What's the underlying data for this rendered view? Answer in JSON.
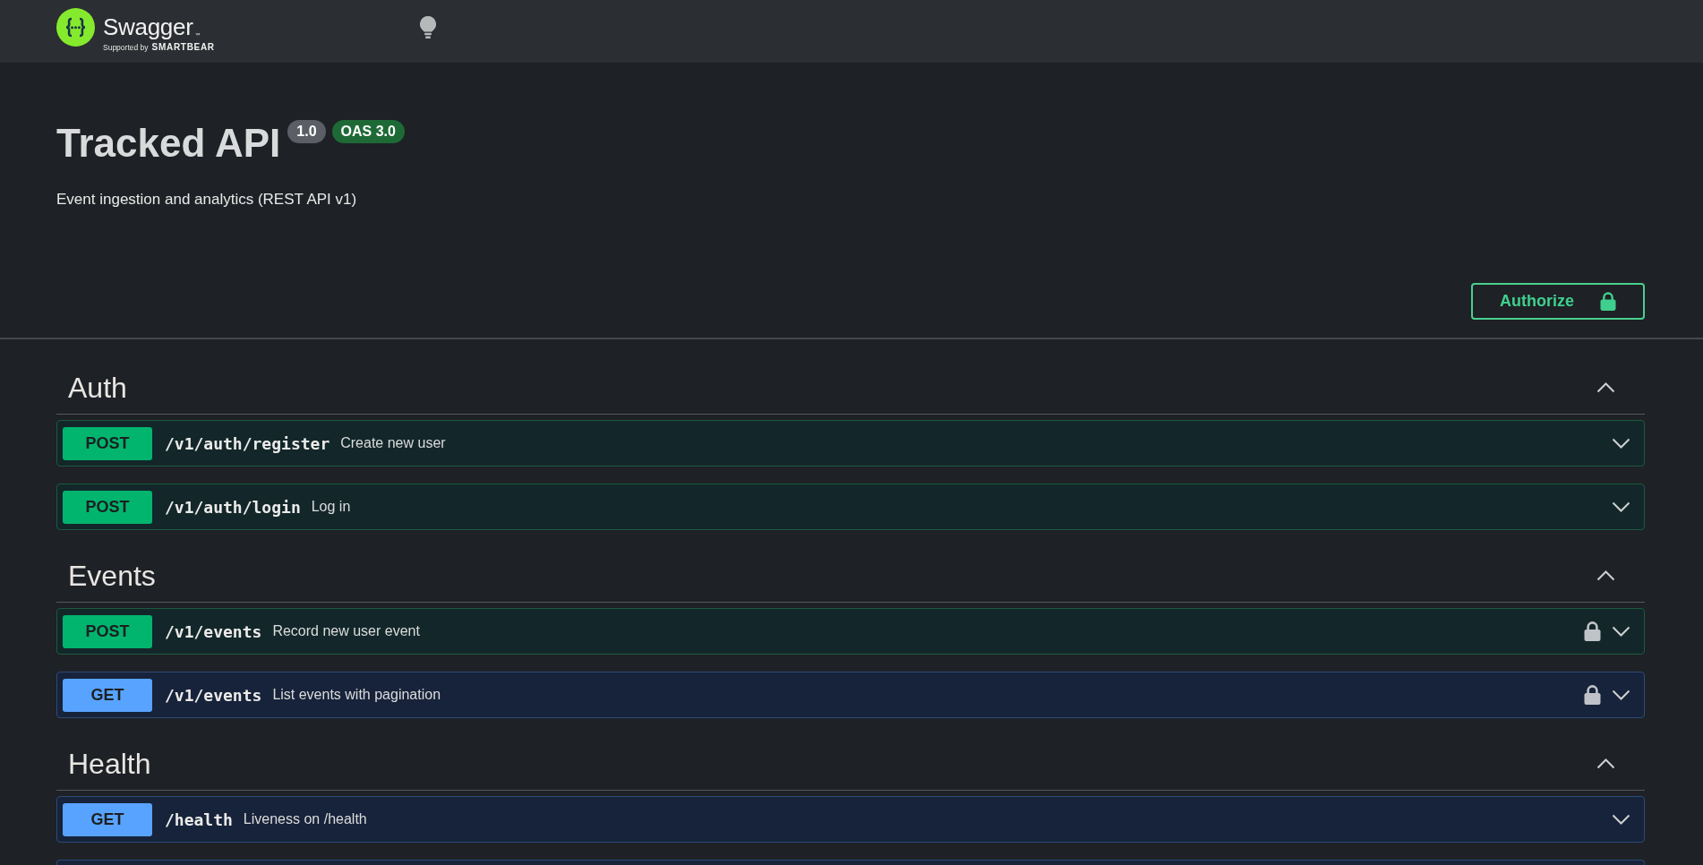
{
  "header": {
    "logo": {
      "name": "Swagger",
      "trademark": "™",
      "tagline": "Supported by",
      "company": "SMARTBEAR"
    }
  },
  "info": {
    "title": "Tracked API",
    "version": "1.0",
    "spec_version": "OAS 3.0",
    "description": "Event ingestion and analytics (REST API v1)"
  },
  "authorize_button": {
    "label": "Authorize"
  },
  "sections": [
    {
      "name": "Auth",
      "expanded": true,
      "operations": [
        {
          "kind": "post",
          "method": "POST",
          "path": "/v1/auth/register",
          "summary": "Create new user",
          "secured": false,
          "expanded": false
        },
        {
          "kind": "post",
          "method": "POST",
          "path": "/v1/auth/login",
          "summary": "Log in",
          "secured": false,
          "expanded": false
        }
      ]
    },
    {
      "name": "Events",
      "expanded": true,
      "operations": [
        {
          "kind": "post",
          "method": "POST",
          "path": "/v1/events",
          "summary": "Record new user event",
          "secured": true,
          "expanded": false
        },
        {
          "kind": "get",
          "method": "GET",
          "path": "/v1/events",
          "summary": "List events with pagination",
          "secured": true,
          "expanded": false
        }
      ]
    },
    {
      "name": "Health",
      "expanded": true,
      "operations": [
        {
          "kind": "get",
          "method": "GET",
          "path": "/health",
          "summary": "Liveness on /health",
          "secured": false,
          "expanded": false
        },
        {
          "kind": "get"
        }
      ]
    }
  ]
}
